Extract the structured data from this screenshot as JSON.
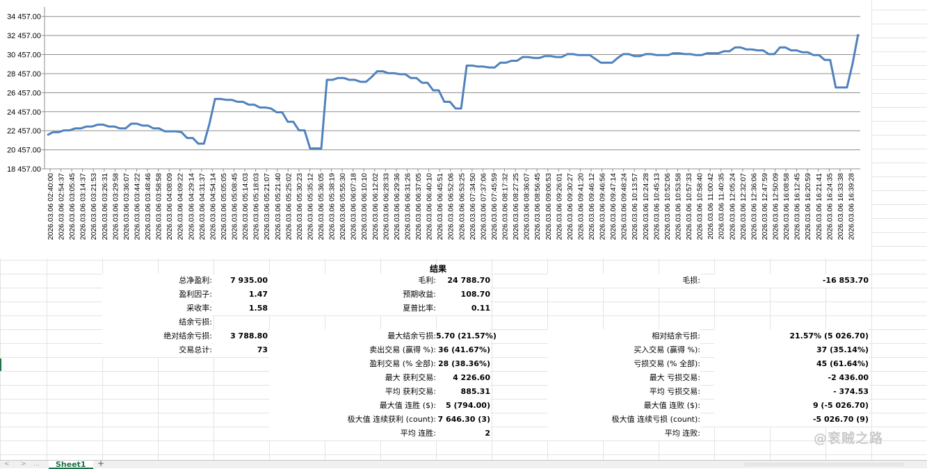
{
  "chart_data": {
    "type": "line",
    "title": "",
    "xlabel": "",
    "ylabel": "",
    "ylim": [
      18457,
      35457
    ],
    "yticks": [
      "18 457.00",
      "20 457.00",
      "22 457.00",
      "24 457.00",
      "26 457.00",
      "28 457.00",
      "30 457.00",
      "32 457.00",
      "34 457.00"
    ],
    "ytick_values": [
      18457,
      20457,
      22457,
      24457,
      26457,
      28457,
      30457,
      32457,
      34457
    ],
    "series_color": "#4f81bd",
    "grid": true,
    "x": [
      "2026.03.06 02:40:00",
      "2026.03.06 02:54:37",
      "2026.03.06 03:05:45",
      "2026.03.06 03:14:37",
      "2026.03.06 03:21:53",
      "2026.03.06 03:26:31",
      "2026.03.06 03:29:58",
      "2026.03.06 03:36:07",
      "2026.03.06 03:44:22",
      "2026.03.06 03:48:46",
      "2026.03.06 03:58:58",
      "2026.03.06 04:08:09",
      "2026.03.06 04:09:22",
      "2026.03.06 04:29:14",
      "2026.03.06 04:31:37",
      "2026.03.06 04:54:14",
      "2026.03.06 05:05:05",
      "2026.03.06 05:08:45",
      "2026.03.06 05:14:03",
      "2026.03.06 05:18:03",
      "2026.03.06 05:21:07",
      "2026.03.06 05:21:40",
      "2026.03.06 05:25:02",
      "2026.03.06 05:30:23",
      "2026.03.06 05:35:12",
      "2026.03.06 05:36:05",
      "2026.03.06 05:38:19",
      "2026.03.06 05:55:30",
      "2026.03.06 06:07:18",
      "2026.03.06 06:10:10",
      "2026.03.06 06:12:02",
      "2026.03.06 06:28:33",
      "2026.03.06 06:29:36",
      "2026.03.06 06:31:26",
      "2026.03.06 06:37:05",
      "2026.03.06 06:40:10",
      "2026.03.06 06:45:51",
      "2026.03.06 06:52:06",
      "2026.03.06 06:53:25",
      "2026.03.06 07:34:50",
      "2026.03.06 07:37:06",
      "2026.03.06 07:45:59",
      "2026.03.06 08:17:32",
      "2026.03.06 08:27:25",
      "2026.03.06 08:36:07",
      "2026.03.06 08:56:45",
      "2026.03.06 09:06:53",
      "2026.03.06 09:26:01",
      "2026.03.06 09:30:27",
      "2026.03.06 09:41:20",
      "2026.03.06 09:46:12",
      "2026.03.06 09:46:56",
      "2026.03.06 09:47:14",
      "2026.03.06 09:48:24",
      "2026.03.06 10:13:57",
      "2026.03.06 10:24:28",
      "2026.03.06 10:45:13",
      "2026.03.06 10:52:06",
      "2026.03.06 10:53:58",
      "2026.03.06 10:57:33",
      "2026.03.06 10:58:40",
      "2026.03.06 11:00:42",
      "2026.03.06 11:40:35",
      "2026.03.06 12:05:24",
      "2026.03.06 12:32:07",
      "2026.03.06 12:36:06",
      "2026.03.06 12:47:59",
      "2026.03.06 12:50:09",
      "2026.03.06 16:08:58",
      "2026.03.06 16:12:45",
      "2026.03.06 16:20:59",
      "2026.03.06 16:21:41",
      "2026.03.06 16:24:35",
      "2026.03.06 16:33:38",
      "2026.03.06 16:39:28"
    ],
    "series": [
      {
        "values": [
          22000,
          22300,
          22300,
          22500,
          22500,
          22700,
          22700,
          22900,
          22900,
          23100,
          23100,
          22900,
          22900,
          22700,
          22700,
          23200,
          23200,
          23000,
          23000,
          22700,
          22700,
          22400,
          22400,
          22400,
          22300,
          21700,
          21700,
          21100,
          21100,
          23200,
          25800,
          25800,
          25700,
          25700,
          25500,
          25500,
          25200,
          25200,
          24900,
          24900,
          24800,
          24400,
          24400,
          23400,
          23400,
          22500,
          22500,
          20600,
          20600,
          20600,
          27800,
          27800,
          28000,
          28000,
          27800,
          27800,
          27600,
          27600,
          28100,
          28700,
          28700,
          28500,
          28500,
          28400,
          28400,
          28000,
          28000,
          27500,
          27500,
          26700,
          26700,
          25500,
          25500,
          24800,
          24800,
          29300,
          29300,
          29200,
          29200,
          29100,
          29100,
          29600,
          29600,
          29800,
          29800,
          30200,
          30200,
          30100,
          30100,
          30300,
          30300,
          30200,
          30200,
          30500,
          30500,
          30400,
          30400,
          30400,
          30000,
          29600,
          29600,
          29600,
          30100,
          30500,
          30500,
          30300,
          30300,
          30500,
          30500,
          30400,
          30400,
          30400,
          30600,
          30600,
          30500,
          30500,
          30400,
          30400,
          30600,
          30600,
          30600,
          30800,
          30800,
          31200,
          31200,
          31000,
          31000,
          30900,
          30900,
          30500,
          30500,
          31200,
          31200,
          30900,
          30900,
          30700,
          30700,
          30400,
          30400,
          29900,
          29900,
          27000,
          27000,
          27000,
          29500,
          32600
        ]
      }
    ]
  },
  "results": {
    "title": "结果",
    "col1": [
      {
        "label": "总净盈利:",
        "value": "7 935.00"
      },
      {
        "label": "盈利因子:",
        "value": "1.47"
      },
      {
        "label": "采收率:",
        "value": "1.58"
      },
      {
        "label": "结余亏损:",
        "value": ""
      },
      {
        "label": "绝对结余亏损:",
        "value": "3 788.80"
      },
      {
        "label": "交易总计:",
        "value": "73"
      }
    ],
    "col2": [
      {
        "label": "毛利:",
        "value": "24 788.70"
      },
      {
        "label": "预期收益:",
        "value": "108.70"
      },
      {
        "label": "夏普比率:",
        "value": "0.11"
      },
      {
        "label": "",
        "value": ""
      },
      {
        "label": "最大结余亏损:",
        "value": "5.70 (21.57%)"
      },
      {
        "label": "卖出交易 (赢得 %):",
        "value": "36 (41.67%)"
      },
      {
        "label": "盈利交易 (% 全部):",
        "value": "28 (38.36%)"
      },
      {
        "label": "最大 获利交易:",
        "value": "4 226.60"
      },
      {
        "label": "平均 获利交易:",
        "value": "885.31"
      },
      {
        "label": "最大值 连胜 ($):",
        "value": "5 (794.00)"
      },
      {
        "label": "极大值 连续获利 (count):",
        "value": "7 646.30 (3)"
      },
      {
        "label": "平均 连胜:",
        "value": "2"
      }
    ],
    "col3": [
      {
        "label": "毛损:",
        "value": "-16 853.70"
      },
      {
        "label": "",
        "value": ""
      },
      {
        "label": "",
        "value": ""
      },
      {
        "label": "",
        "value": ""
      },
      {
        "label": "相对结余亏损:",
        "value": "21.57% (5 026.70)"
      },
      {
        "label": "买入交易 (赢得 %):",
        "value": "37 (35.14%)"
      },
      {
        "label": "亏损交易 (% 全部):",
        "value": "45 (61.64%)"
      },
      {
        "label": "最大 亏损交易:",
        "value": "-2 436.00"
      },
      {
        "label": "平均 亏损交易:",
        "value": "- 374.53"
      },
      {
        "label": "最大值 连败 ($):",
        "value": "9 (-5 026.70)"
      },
      {
        "label": "极大值 连续亏损 (count):",
        "value": "-5 026.70 (9)"
      },
      {
        "label": "平均 连败:",
        "value": ""
      }
    ]
  },
  "sheet": {
    "tab_label": "Sheet1",
    "add_tab": "+",
    "nav_prev": "<",
    "nav_next": ">",
    "nav_more": "..."
  },
  "watermark": "@衮贼之路"
}
